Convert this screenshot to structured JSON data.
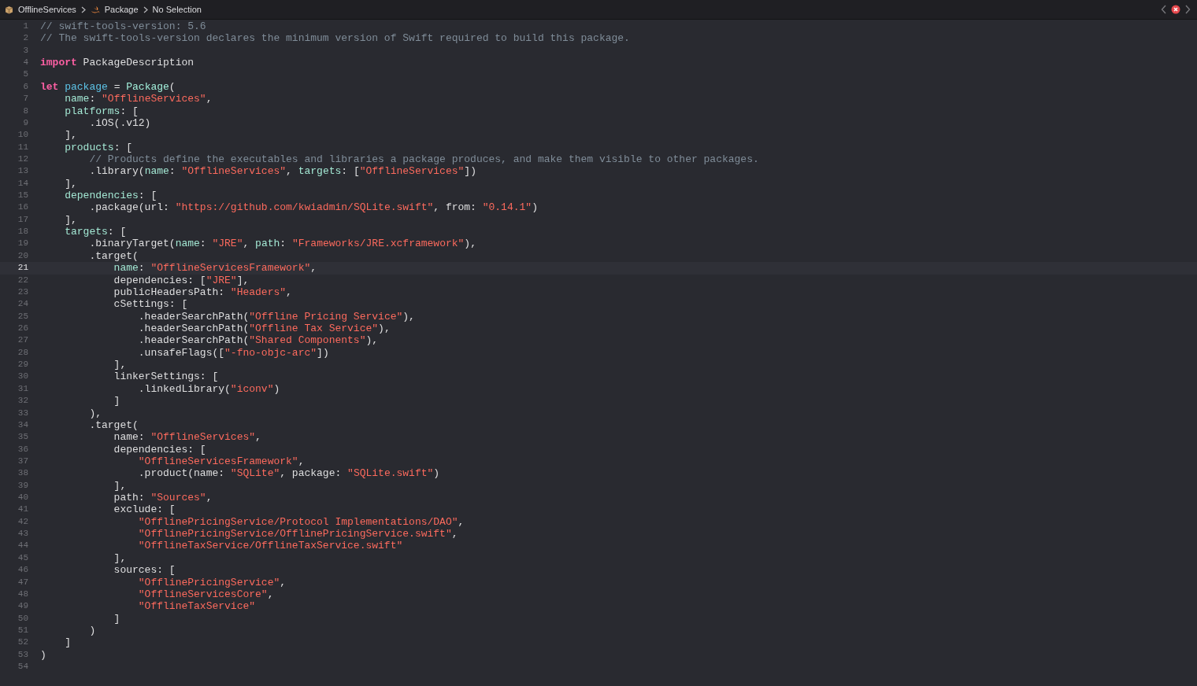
{
  "breadcrumb": [
    {
      "kind": "package",
      "label": "OfflineServices"
    },
    {
      "kind": "swift",
      "label": "Package"
    },
    {
      "kind": "none",
      "label": "No Selection"
    }
  ],
  "issue_indicator": {
    "kind": "error"
  },
  "editor": {
    "lines": [
      {
        "number": "1",
        "current": false,
        "tokens": [
          {
            "kind": "comment",
            "text": "// swift-tools-version: 5.6"
          }
        ]
      },
      {
        "number": "2",
        "current": false,
        "tokens": [
          {
            "kind": "comment",
            "text": "// The swift-tools-version declares the minimum version of Swift required to build this package."
          }
        ]
      },
      {
        "number": "3",
        "current": false
      },
      {
        "number": "4",
        "current": false,
        "tokens": [
          {
            "kind": "keyword",
            "text": "import"
          },
          {
            "kind": "plain",
            "text": " PackageDescription"
          }
        ]
      },
      {
        "number": "5",
        "current": false
      },
      {
        "number": "6",
        "current": false,
        "tokens": [
          {
            "kind": "keyword",
            "text": "let"
          },
          {
            "kind": "variable",
            "text": " package"
          },
          {
            "kind": "plain",
            "text": " = "
          },
          {
            "kind": "type",
            "text": "Package"
          },
          {
            "kind": "plain",
            "text": "("
          }
        ]
      },
      {
        "number": "7",
        "current": false,
        "tokens": [
          {
            "kind": "label",
            "text": "    name"
          },
          {
            "kind": "plain",
            "text": ": "
          },
          {
            "kind": "string",
            "text": "\"OfflineServices\""
          },
          {
            "kind": "plain",
            "text": ","
          }
        ]
      },
      {
        "number": "8",
        "current": false,
        "tokens": [
          {
            "kind": "label",
            "text": "    platforms"
          },
          {
            "kind": "plain",
            "text": ": ["
          }
        ]
      },
      {
        "number": "9",
        "current": false,
        "tokens": [
          {
            "kind": "plain",
            "text": "        .iOS(.v12)"
          }
        ]
      },
      {
        "number": "10",
        "current": false,
        "tokens": [
          {
            "kind": "plain",
            "text": "    ],"
          }
        ]
      },
      {
        "number": "11",
        "current": false,
        "tokens": [
          {
            "kind": "label",
            "text": "    products"
          },
          {
            "kind": "plain",
            "text": ": ["
          }
        ]
      },
      {
        "number": "12",
        "current": false,
        "tokens": [
          {
            "kind": "comment",
            "text": "        // Products define the executables and libraries a package produces, and make them visible to other packages."
          }
        ]
      },
      {
        "number": "13",
        "current": false,
        "tokens": [
          {
            "kind": "plain",
            "text": "        .library("
          },
          {
            "kind": "label",
            "text": "name"
          },
          {
            "kind": "plain",
            "text": ": "
          },
          {
            "kind": "string",
            "text": "\"OfflineServices\""
          },
          {
            "kind": "plain",
            "text": ", "
          },
          {
            "kind": "label",
            "text": "targets"
          },
          {
            "kind": "plain",
            "text": ": ["
          },
          {
            "kind": "string",
            "text": "\"OfflineServices\""
          },
          {
            "kind": "plain",
            "text": "])"
          }
        ]
      },
      {
        "number": "14",
        "current": false,
        "tokens": [
          {
            "kind": "plain",
            "text": "    ],"
          }
        ]
      },
      {
        "number": "15",
        "current": false,
        "tokens": [
          {
            "kind": "label",
            "text": "    dependencies"
          },
          {
            "kind": "plain",
            "text": ": ["
          }
        ]
      },
      {
        "number": "16",
        "current": false,
        "tokens": [
          {
            "kind": "plain",
            "text": "        .package(url: "
          },
          {
            "kind": "string",
            "text": "\"https://github.com/kwiadmin/SQLite.swift\""
          },
          {
            "kind": "plain",
            "text": ", from: "
          },
          {
            "kind": "string",
            "text": "\"0.14.1\""
          },
          {
            "kind": "plain",
            "text": ")"
          }
        ]
      },
      {
        "number": "17",
        "current": false,
        "tokens": [
          {
            "kind": "plain",
            "text": "    ],"
          }
        ]
      },
      {
        "number": "18",
        "current": false,
        "tokens": [
          {
            "kind": "label",
            "text": "    targets"
          },
          {
            "kind": "plain",
            "text": ": ["
          }
        ]
      },
      {
        "number": "19",
        "current": false,
        "tokens": [
          {
            "kind": "plain",
            "text": "        .binaryTarget("
          },
          {
            "kind": "label",
            "text": "name"
          },
          {
            "kind": "plain",
            "text": ": "
          },
          {
            "kind": "string",
            "text": "\"JRE\""
          },
          {
            "kind": "plain",
            "text": ", "
          },
          {
            "kind": "label",
            "text": "path"
          },
          {
            "kind": "plain",
            "text": ": "
          },
          {
            "kind": "string",
            "text": "\"Frameworks/JRE.xcframework\""
          },
          {
            "kind": "plain",
            "text": "),"
          }
        ]
      },
      {
        "number": "20",
        "current": false,
        "tokens": [
          {
            "kind": "plain",
            "text": "        .target("
          }
        ]
      },
      {
        "number": "21",
        "current": true,
        "tokens": [
          {
            "kind": "label",
            "text": "            name"
          },
          {
            "kind": "plain",
            "text": ": "
          },
          {
            "kind": "string",
            "text": "\"OfflineServicesFramework\""
          },
          {
            "kind": "plain",
            "text": ","
          }
        ]
      },
      {
        "number": "22",
        "current": false,
        "tokens": [
          {
            "kind": "plain",
            "text": "            dependencies: ["
          },
          {
            "kind": "string",
            "text": "\"JRE\""
          },
          {
            "kind": "plain",
            "text": "],"
          }
        ]
      },
      {
        "number": "23",
        "current": false,
        "tokens": [
          {
            "kind": "plain",
            "text": "            publicHeadersPath: "
          },
          {
            "kind": "string",
            "text": "\"Headers\""
          },
          {
            "kind": "plain",
            "text": ","
          }
        ]
      },
      {
        "number": "24",
        "current": false,
        "tokens": [
          {
            "kind": "plain",
            "text": "            cSettings: ["
          }
        ]
      },
      {
        "number": "25",
        "current": false,
        "tokens": [
          {
            "kind": "plain",
            "text": "                .headerSearchPath("
          },
          {
            "kind": "string",
            "text": "\"Offline Pricing Service\""
          },
          {
            "kind": "plain",
            "text": "),"
          }
        ]
      },
      {
        "number": "26",
        "current": false,
        "tokens": [
          {
            "kind": "plain",
            "text": "                .headerSearchPath("
          },
          {
            "kind": "string",
            "text": "\"Offline Tax Service\""
          },
          {
            "kind": "plain",
            "text": "),"
          }
        ]
      },
      {
        "number": "27",
        "current": false,
        "tokens": [
          {
            "kind": "plain",
            "text": "                .headerSearchPath("
          },
          {
            "kind": "string",
            "text": "\"Shared Components\""
          },
          {
            "kind": "plain",
            "text": "),"
          }
        ]
      },
      {
        "number": "28",
        "current": false,
        "tokens": [
          {
            "kind": "plain",
            "text": "                .unsafeFlags(["
          },
          {
            "kind": "string",
            "text": "\"-fno-objc-arc\""
          },
          {
            "kind": "plain",
            "text": "])"
          }
        ]
      },
      {
        "number": "29",
        "current": false,
        "tokens": [
          {
            "kind": "plain",
            "text": "            ],"
          }
        ]
      },
      {
        "number": "30",
        "current": false,
        "tokens": [
          {
            "kind": "plain",
            "text": "            linkerSettings: ["
          }
        ]
      },
      {
        "number": "31",
        "current": false,
        "tokens": [
          {
            "kind": "plain",
            "text": "                .linkedLibrary("
          },
          {
            "kind": "string",
            "text": "\"iconv\""
          },
          {
            "kind": "plain",
            "text": ")"
          }
        ]
      },
      {
        "number": "32",
        "current": false,
        "tokens": [
          {
            "kind": "plain",
            "text": "            ]"
          }
        ]
      },
      {
        "number": "33",
        "current": false,
        "tokens": [
          {
            "kind": "plain",
            "text": "        ),"
          }
        ]
      },
      {
        "number": "34",
        "current": false,
        "tokens": [
          {
            "kind": "plain",
            "text": "        .target("
          }
        ]
      },
      {
        "number": "35",
        "current": false,
        "tokens": [
          {
            "kind": "plain",
            "text": "            name: "
          },
          {
            "kind": "string",
            "text": "\"OfflineServices\""
          },
          {
            "kind": "plain",
            "text": ","
          }
        ]
      },
      {
        "number": "36",
        "current": false,
        "tokens": [
          {
            "kind": "plain",
            "text": "            dependencies: ["
          }
        ]
      },
      {
        "number": "37",
        "current": false,
        "tokens": [
          {
            "kind": "string",
            "text": "                \"OfflineServicesFramework\""
          },
          {
            "kind": "plain",
            "text": ","
          }
        ]
      },
      {
        "number": "38",
        "current": false,
        "tokens": [
          {
            "kind": "plain",
            "text": "                .product(name: "
          },
          {
            "kind": "string",
            "text": "\"SQLite\""
          },
          {
            "kind": "plain",
            "text": ", package: "
          },
          {
            "kind": "string",
            "text": "\"SQLite.swift\""
          },
          {
            "kind": "plain",
            "text": ")"
          }
        ]
      },
      {
        "number": "39",
        "current": false,
        "tokens": [
          {
            "kind": "plain",
            "text": "            ],"
          }
        ]
      },
      {
        "number": "40",
        "current": false,
        "tokens": [
          {
            "kind": "plain",
            "text": "            path: "
          },
          {
            "kind": "string",
            "text": "\"Sources\""
          },
          {
            "kind": "plain",
            "text": ","
          }
        ]
      },
      {
        "number": "41",
        "current": false,
        "tokens": [
          {
            "kind": "plain",
            "text": "            exclude: ["
          }
        ]
      },
      {
        "number": "42",
        "current": false,
        "tokens": [
          {
            "kind": "string",
            "text": "                \"OfflinePricingService/Protocol Implementations/DAO\""
          },
          {
            "kind": "plain",
            "text": ","
          }
        ]
      },
      {
        "number": "43",
        "current": false,
        "tokens": [
          {
            "kind": "string",
            "text": "                \"OfflinePricingService/OfflinePricingService.swift\""
          },
          {
            "kind": "plain",
            "text": ","
          }
        ]
      },
      {
        "number": "44",
        "current": false,
        "tokens": [
          {
            "kind": "string",
            "text": "                \"OfflineTaxService/OfflineTaxService.swift\""
          }
        ]
      },
      {
        "number": "45",
        "current": false,
        "tokens": [
          {
            "kind": "plain",
            "text": "            ],"
          }
        ]
      },
      {
        "number": "46",
        "current": false,
        "tokens": [
          {
            "kind": "plain",
            "text": "            sources: ["
          }
        ]
      },
      {
        "number": "47",
        "current": false,
        "tokens": [
          {
            "kind": "string",
            "text": "                \"OfflinePricingService\""
          },
          {
            "kind": "plain",
            "text": ","
          }
        ]
      },
      {
        "number": "48",
        "current": false,
        "tokens": [
          {
            "kind": "string",
            "text": "                \"OfflineServicesCore\""
          },
          {
            "kind": "plain",
            "text": ","
          }
        ]
      },
      {
        "number": "49",
        "current": false,
        "tokens": [
          {
            "kind": "string",
            "text": "                \"OfflineTaxService\""
          }
        ]
      },
      {
        "number": "50",
        "current": false,
        "tokens": [
          {
            "kind": "plain",
            "text": "            ]"
          }
        ]
      },
      {
        "number": "51",
        "current": false,
        "tokens": [
          {
            "kind": "plain",
            "text": "        )"
          }
        ]
      },
      {
        "number": "52",
        "current": false,
        "tokens": [
          {
            "kind": "plain",
            "text": "    ]"
          }
        ]
      },
      {
        "number": "53",
        "current": false,
        "tokens": [
          {
            "kind": "plain",
            "text": ")"
          }
        ]
      },
      {
        "number": "54",
        "current": false
      }
    ]
  }
}
